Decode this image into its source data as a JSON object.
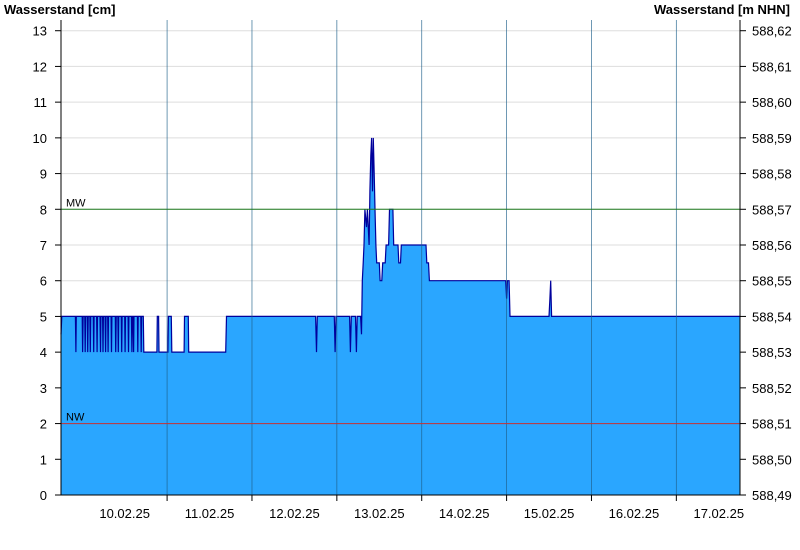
{
  "chart_data": {
    "type": "area",
    "left_axis": {
      "title": "Wasserstand [cm]",
      "ylim": [
        0,
        13.3
      ],
      "ticks": [
        0,
        1,
        2,
        3,
        4,
        5,
        6,
        7,
        8,
        9,
        10,
        11,
        12,
        13
      ],
      "tick_labels": [
        "0",
        "1",
        "2",
        "3",
        "4",
        "5",
        "6",
        "7",
        "8",
        "9",
        "10",
        "11",
        "12",
        "13"
      ]
    },
    "right_axis": {
      "title": "Wasserstand [m NHN]",
      "ticks": [
        0,
        1,
        2,
        3,
        4,
        5,
        6,
        7,
        8,
        9,
        10,
        11,
        12,
        13
      ],
      "tick_labels": [
        "588,49",
        "588,50",
        "588,51",
        "588,52",
        "588,53",
        "588,54",
        "588,55",
        "588,56",
        "588,57",
        "588,58",
        "588,59",
        "588,60",
        "588,61",
        "588,62"
      ]
    },
    "x_axis": {
      "xlim": [
        9.75,
        17.75
      ],
      "tick_labels": [
        "10.02.25",
        "11.02.25",
        "12.02.25",
        "13.02.25",
        "14.02.25",
        "15.02.25",
        "16.02.25",
        "17.02.25"
      ],
      "label_positions": [
        10.5,
        11.5,
        12.5,
        13.5,
        14.5,
        15.5,
        16.5,
        17.5
      ],
      "day_boundaries": [
        11,
        12,
        13,
        14,
        15,
        16,
        17
      ]
    },
    "reference_lines": [
      {
        "label": "MW",
        "value": 8,
        "color": "#1f7a1f"
      },
      {
        "label": "NW",
        "value": 2,
        "color": "#c83030"
      }
    ],
    "series": [
      {
        "fill_color": "#2aa6ff",
        "line_color": "#00009c",
        "points": [
          [
            9.75,
            4.5
          ],
          [
            9.76,
            5
          ],
          [
            9.92,
            5
          ],
          [
            9.925,
            4
          ],
          [
            9.93,
            5
          ],
          [
            10.0,
            5
          ],
          [
            10.005,
            4
          ],
          [
            10.01,
            5
          ],
          [
            10.03,
            5
          ],
          [
            10.035,
            4
          ],
          [
            10.04,
            5
          ],
          [
            10.06,
            5
          ],
          [
            10.065,
            4
          ],
          [
            10.07,
            5
          ],
          [
            10.09,
            5
          ],
          [
            10.095,
            4
          ],
          [
            10.1,
            5
          ],
          [
            10.13,
            5
          ],
          [
            10.135,
            4
          ],
          [
            10.14,
            5
          ],
          [
            10.17,
            5
          ],
          [
            10.175,
            4
          ],
          [
            10.18,
            5
          ],
          [
            10.21,
            5
          ],
          [
            10.215,
            4
          ],
          [
            10.22,
            5
          ],
          [
            10.24,
            5
          ],
          [
            10.245,
            4
          ],
          [
            10.25,
            5
          ],
          [
            10.27,
            5
          ],
          [
            10.275,
            4
          ],
          [
            10.28,
            5
          ],
          [
            10.3,
            5
          ],
          [
            10.305,
            4
          ],
          [
            10.31,
            5
          ],
          [
            10.34,
            5
          ],
          [
            10.345,
            4
          ],
          [
            10.35,
            5
          ],
          [
            10.39,
            5
          ],
          [
            10.395,
            4
          ],
          [
            10.4,
            5
          ],
          [
            10.42,
            5
          ],
          [
            10.425,
            4
          ],
          [
            10.43,
            5
          ],
          [
            10.46,
            5
          ],
          [
            10.465,
            4
          ],
          [
            10.47,
            5
          ],
          [
            10.5,
            5
          ],
          [
            10.505,
            4
          ],
          [
            10.51,
            5
          ],
          [
            10.54,
            5
          ],
          [
            10.545,
            4
          ],
          [
            10.55,
            5
          ],
          [
            10.58,
            5
          ],
          [
            10.585,
            4
          ],
          [
            10.59,
            5
          ],
          [
            10.6,
            5
          ],
          [
            10.605,
            4
          ],
          [
            10.61,
            5
          ],
          [
            10.65,
            5
          ],
          [
            10.655,
            4
          ],
          [
            10.66,
            5
          ],
          [
            10.69,
            5
          ],
          [
            10.695,
            4
          ],
          [
            10.7,
            5
          ],
          [
            10.72,
            5
          ],
          [
            10.725,
            4
          ],
          [
            10.88,
            4
          ],
          [
            10.885,
            5
          ],
          [
            10.9,
            5
          ],
          [
            10.905,
            4
          ],
          [
            11.01,
            4
          ],
          [
            11.015,
            5
          ],
          [
            11.05,
            5
          ],
          [
            11.055,
            4
          ],
          [
            11.2,
            4
          ],
          [
            11.205,
            5
          ],
          [
            11.25,
            5
          ],
          [
            11.255,
            4
          ],
          [
            11.69,
            4
          ],
          [
            11.7,
            5
          ],
          [
            12.75,
            5
          ],
          [
            12.76,
            4
          ],
          [
            12.77,
            5
          ],
          [
            12.97,
            5
          ],
          [
            12.98,
            4
          ],
          [
            12.99,
            5
          ],
          [
            13.15,
            5
          ],
          [
            13.16,
            4
          ],
          [
            13.17,
            5
          ],
          [
            13.22,
            5
          ],
          [
            13.23,
            4
          ],
          [
            13.24,
            5
          ],
          [
            13.28,
            5
          ],
          [
            13.29,
            4.5
          ],
          [
            13.3,
            6
          ],
          [
            13.31,
            6.5
          ],
          [
            13.32,
            7
          ],
          [
            13.33,
            8
          ],
          [
            13.35,
            7.5
          ],
          [
            13.36,
            8
          ],
          [
            13.38,
            7
          ],
          [
            13.39,
            8.5
          ],
          [
            13.4,
            9.5
          ],
          [
            13.41,
            10
          ],
          [
            13.42,
            8.5
          ],
          [
            13.43,
            10
          ],
          [
            13.44,
            9
          ],
          [
            13.45,
            8
          ],
          [
            13.46,
            7
          ],
          [
            13.47,
            6.5
          ],
          [
            13.5,
            6.5
          ],
          [
            13.51,
            6
          ],
          [
            13.53,
            6
          ],
          [
            13.54,
            6.5
          ],
          [
            13.57,
            6.5
          ],
          [
            13.58,
            7
          ],
          [
            13.61,
            7
          ],
          [
            13.62,
            8
          ],
          [
            13.66,
            8
          ],
          [
            13.67,
            7
          ],
          [
            13.72,
            7
          ],
          [
            13.73,
            6.5
          ],
          [
            13.75,
            6.5
          ],
          [
            13.76,
            7
          ],
          [
            14.05,
            7
          ],
          [
            14.06,
            6.5
          ],
          [
            14.08,
            6.5
          ],
          [
            14.09,
            6
          ],
          [
            14.1,
            6
          ],
          [
            14.99,
            6
          ],
          [
            15.0,
            5.5
          ],
          [
            15.01,
            6
          ],
          [
            15.03,
            6
          ],
          [
            15.04,
            5
          ],
          [
            15.5,
            5
          ],
          [
            15.51,
            5.5
          ],
          [
            15.52,
            6
          ],
          [
            15.53,
            5
          ],
          [
            17.75,
            5
          ]
        ]
      }
    ]
  }
}
